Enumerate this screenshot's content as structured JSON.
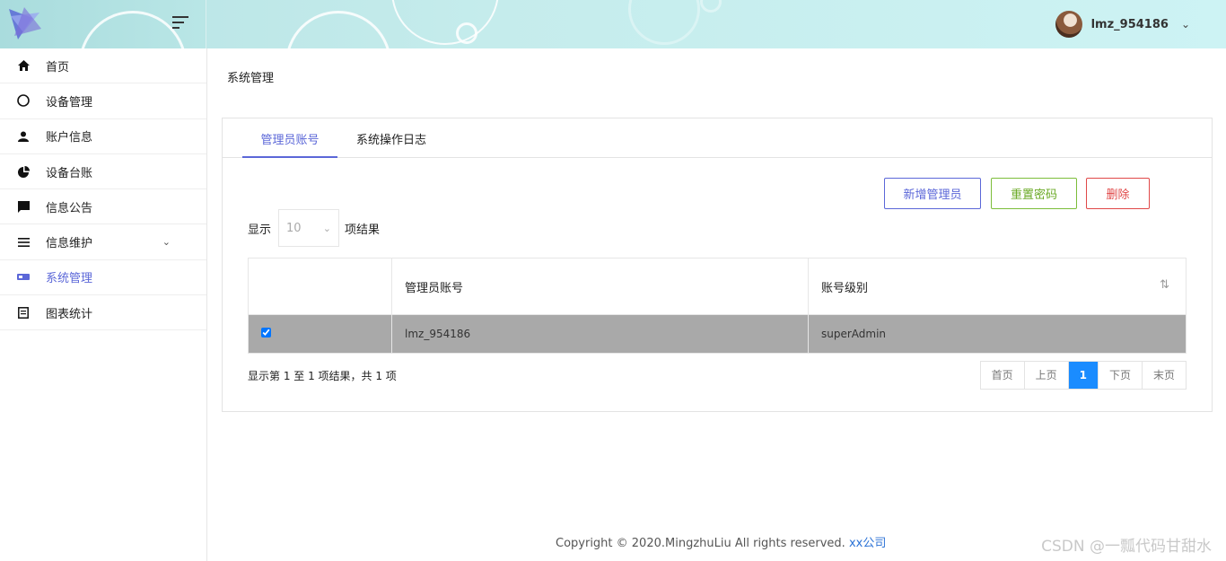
{
  "header": {
    "username": "lmz_954186"
  },
  "sidebar": {
    "items": [
      {
        "label": "首页",
        "icon": "home-icon"
      },
      {
        "label": "设备管理",
        "icon": "circle-icon"
      },
      {
        "label": "账户信息",
        "icon": "user-icon"
      },
      {
        "label": "设备台账",
        "icon": "pie-chart-icon"
      },
      {
        "label": "信息公告",
        "icon": "message-icon"
      },
      {
        "label": "信息维护",
        "icon": "list-icon"
      },
      {
        "label": "系统管理",
        "icon": "card-icon"
      },
      {
        "label": "图表统计",
        "icon": "document-icon"
      }
    ]
  },
  "breadcrumb": "系统管理",
  "tabs": [
    "管理员账号",
    "系统操作日志"
  ],
  "buttons": {
    "add": "新增管理员",
    "reset": "重置密码",
    "delete": "删除"
  },
  "length": {
    "prefix": "显示",
    "value": "10",
    "suffix": "项结果"
  },
  "table": {
    "headers": [
      "",
      "管理员账号",
      "账号级别"
    ],
    "rows": [
      {
        "checked": true,
        "account": "lmz_954186",
        "level": "superAdmin"
      }
    ]
  },
  "info": "显示第 1 至 1 项结果，共 1 项",
  "pager": [
    "首页",
    "上页",
    "1",
    "下页",
    "末页"
  ],
  "footer": {
    "text": "Copyright © 2020.MingzhuLiu All rights reserved.",
    "link": "xx公司"
  },
  "watermark": "CSDN @一瓢代码甘甜水",
  "colors": {
    "accent": "#5b67d8",
    "success": "#7cbd3a",
    "danger": "#e04848",
    "page_active": "#1a8cff",
    "selected_row": "#a9a9a9"
  }
}
